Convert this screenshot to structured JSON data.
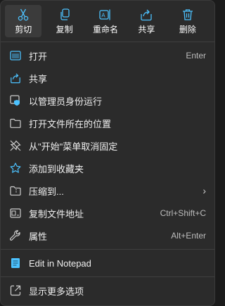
{
  "toolbar": {
    "cut": "剪切",
    "copy": "复制",
    "rename": "重命名",
    "share": "共享",
    "delete": "删除"
  },
  "menu": {
    "open": {
      "label": "打开",
      "shortcut": "Enter"
    },
    "share": {
      "label": "共享"
    },
    "run_as_admin": {
      "label": "以管理员身份运行"
    },
    "open_location": {
      "label": "打开文件所在的位置"
    },
    "unpin_start": {
      "label": "从\"开始\"菜单取消固定"
    },
    "add_favorites": {
      "label": "添加到收藏夹"
    },
    "compress": {
      "label": "压缩到..."
    },
    "copy_path": {
      "label": "复制文件地址",
      "shortcut": "Ctrl+Shift+C"
    },
    "properties": {
      "label": "属性",
      "shortcut": "Alt+Enter"
    },
    "edit_notepad": {
      "label": "Edit in Notepad"
    },
    "more_options": {
      "label": "显示更多选项"
    }
  },
  "icons": [
    "scissors-icon",
    "copy-icon",
    "rename-icon",
    "share-icon",
    "trash-icon",
    "open-icon",
    "share-icon",
    "shield-icon",
    "folder-icon",
    "unpin-icon",
    "star-icon",
    "compress-icon",
    "copy-path-icon",
    "wrench-icon",
    "notepad-icon",
    "more-options-icon"
  ],
  "colors": {
    "accent": "#4cc2ff",
    "background": "#2b2b2b"
  }
}
